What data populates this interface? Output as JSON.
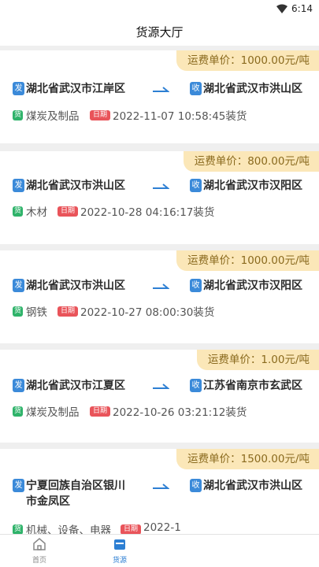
{
  "status": {
    "time": "6:14"
  },
  "header": {
    "title": "货源大厅"
  },
  "labels": {
    "from_tag": "发",
    "to_tag": "收",
    "goods_tag": "货",
    "date_tag": "日期"
  },
  "cards": [
    {
      "price": "运费单价：1000.00元/吨",
      "from": "湖北省武汉市江岸区",
      "to": "湖北省武汉市洪山区",
      "goods": "煤炭及制品",
      "date": "2022-11-07 10:58:45装货"
    },
    {
      "price": "运费单价：800.00元/吨",
      "from": "湖北省武汉市洪山区",
      "to": "湖北省武汉市汉阳区",
      "goods": "木材",
      "date": "2022-10-28 04:16:17装货"
    },
    {
      "price": "运费单价：1000.00元/吨",
      "from": "湖北省武汉市洪山区",
      "to": "湖北省武汉市汉阳区",
      "goods": "钢铁",
      "date": "2022-10-27 08:00:30装货"
    },
    {
      "price": "运费单价：1.00元/吨",
      "from": "湖北省武汉市江夏区",
      "to": "江苏省南京市玄武区",
      "goods": "煤炭及制品",
      "date": "2022-10-26 03:21:12装货"
    },
    {
      "price": "运费单价：1500.00元/吨",
      "from": "宁夏回族自治区银川",
      "from2": "市金凤区",
      "to": "湖北省武汉市洪山区",
      "goods": "机械、设备、电器",
      "date": "2022-1"
    }
  ],
  "tabbar": {
    "home_label": "首页",
    "source_label": "货源"
  },
  "colors": {
    "accent": "#2d7fd3",
    "price_bg": "#fbe7b8",
    "from_tag": "#3b8ad9",
    "goods_tag": "#2fb36a",
    "date_tag": "#e9545a"
  }
}
